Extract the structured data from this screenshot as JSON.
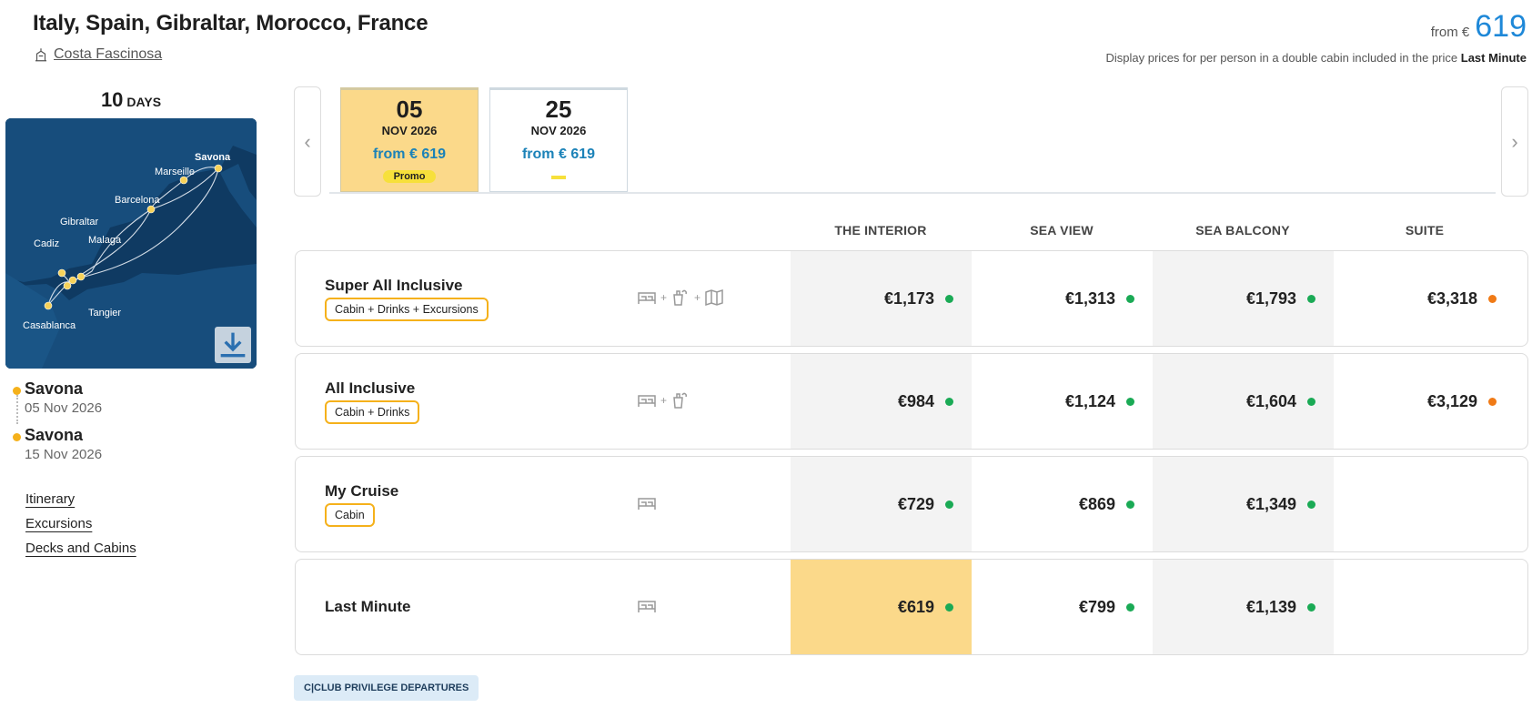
{
  "header": {
    "title": "Italy, Spain, Gibraltar, Morocco, France",
    "ship_name": "Costa Fascinosa",
    "price_from_label": "from €",
    "price_from_value": "619",
    "price_note": "Display prices for per person in a double cabin included in the price",
    "price_note_bold": "Last Minute"
  },
  "itinerary": {
    "days_number": "10",
    "days_label": "DAYS",
    "map_labels": [
      "Savona",
      "Marseille",
      "Barcelona",
      "Gibraltar",
      "Malaga",
      "Cadiz",
      "Tangier",
      "Casablanca"
    ],
    "departure": {
      "port": "Savona",
      "date": "05 Nov 2026"
    },
    "arrival": {
      "port": "Savona",
      "date": "15 Nov 2026"
    },
    "links": [
      "Itinerary",
      "Excursions",
      "Decks and Cabins"
    ]
  },
  "dates": [
    {
      "day": "05",
      "month": "NOV 2026",
      "from": "from € 619",
      "promo": "Promo",
      "active": true
    },
    {
      "day": "25",
      "month": "NOV 2026",
      "from": "from € 619",
      "promo": "",
      "active": false
    }
  ],
  "cabin_columns": [
    "THE INTERIOR",
    "SEA VIEW",
    "SEA BALCONY",
    "SUITE"
  ],
  "fares": [
    {
      "name": "Super All Inclusive",
      "tag": "Cabin + Drinks + Excursions",
      "icons": [
        "bed-icon",
        "drinks-icon",
        "map-icon"
      ],
      "prices": [
        "€1,173",
        "€1,313",
        "€1,793",
        "€3,318"
      ],
      "status": [
        "green",
        "green",
        "green",
        "orange"
      ]
    },
    {
      "name": "All Inclusive",
      "tag": "Cabin + Drinks",
      "icons": [
        "bed-icon",
        "drinks-icon"
      ],
      "prices": [
        "€984",
        "€1,124",
        "€1,604",
        "€3,129"
      ],
      "status": [
        "green",
        "green",
        "green",
        "orange"
      ]
    },
    {
      "name": "My Cruise",
      "tag": "Cabin",
      "icons": [
        "bed-icon"
      ],
      "prices": [
        "€729",
        "€869",
        "€1,349",
        ""
      ],
      "status": [
        "green",
        "green",
        "green",
        ""
      ]
    },
    {
      "name": "Last Minute",
      "tag": "",
      "icons": [
        "bed-icon"
      ],
      "prices": [
        "€619",
        "€799",
        "€1,139",
        ""
      ],
      "status": [
        "green",
        "green",
        "green",
        ""
      ],
      "highlight_index": 0
    }
  ],
  "club_label": "C|CLUB PRIVILEGE DEPARTURES",
  "colors": {
    "accent_blue": "#1e88d8",
    "promo_yellow": "#fbd98a",
    "badge_yellow": "#f7e03b",
    "status_green": "#1aaa55",
    "status_orange": "#f07a16",
    "tag_border": "#f5b11b"
  }
}
